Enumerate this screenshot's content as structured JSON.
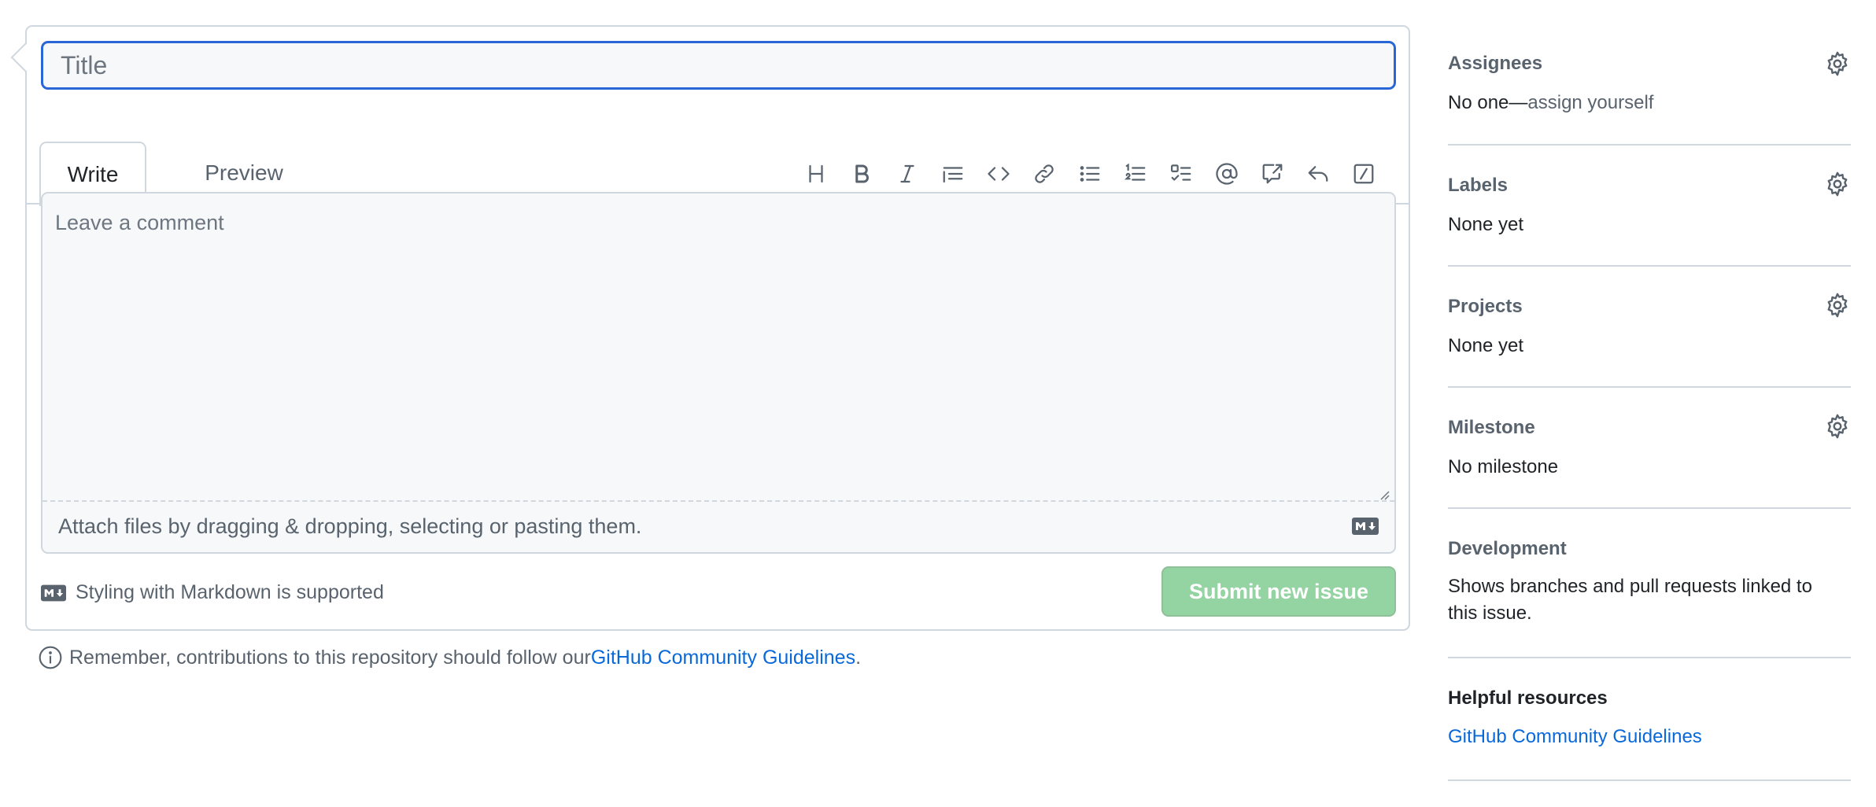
{
  "form": {
    "title_placeholder": "Title",
    "tabs": {
      "write": "Write",
      "preview": "Preview"
    },
    "toolbar": [
      {
        "icon": "heading-icon",
        "name": "heading-button"
      },
      {
        "icon": "bold-icon",
        "name": "bold-button"
      },
      {
        "icon": "italic-icon",
        "name": "italic-button"
      },
      {
        "icon": "quote-icon",
        "name": "quote-button"
      },
      {
        "icon": "code-icon",
        "name": "code-button"
      },
      {
        "icon": "link-icon",
        "name": "link-button"
      },
      {
        "icon": "unordered-list-icon",
        "name": "unordered-list-button"
      },
      {
        "icon": "ordered-list-icon",
        "name": "ordered-list-button"
      },
      {
        "icon": "task-list-icon",
        "name": "task-list-button"
      },
      {
        "icon": "mention-icon",
        "name": "mention-button"
      },
      {
        "icon": "cross-reference-icon",
        "name": "cross-reference-button"
      },
      {
        "icon": "reply-icon",
        "name": "saved-reply-button"
      },
      {
        "icon": "slash-command-icon",
        "name": "slash-command-button"
      }
    ],
    "comment_placeholder": "Leave a comment",
    "attach_text": "Attach files by dragging & dropping, selecting or pasting them.",
    "markdown_note": "Styling with Markdown is supported",
    "submit_label": "Submit new issue"
  },
  "guidelines": {
    "prefix": "Remember, contributions to this repository should follow our ",
    "link_text": "GitHub Community Guidelines",
    "suffix": "."
  },
  "sidebar": {
    "assignees": {
      "heading": "Assignees",
      "value_prefix": "No one—",
      "value_action": "assign yourself"
    },
    "labels": {
      "heading": "Labels",
      "value": "None yet"
    },
    "projects": {
      "heading": "Projects",
      "value": "None yet"
    },
    "milestone": {
      "heading": "Milestone",
      "value": "No milestone"
    },
    "development": {
      "heading": "Development",
      "value": "Shows branches and pull requests linked to this issue."
    },
    "helpful": {
      "heading": "Helpful resources",
      "link": "GitHub Community Guidelines"
    }
  },
  "colors": {
    "accent_blue": "#0969da",
    "focus_border": "#2a67d6",
    "submit_disabled": "#94d3a2",
    "border": "#d0d7de",
    "muted_text": "#59636e"
  }
}
